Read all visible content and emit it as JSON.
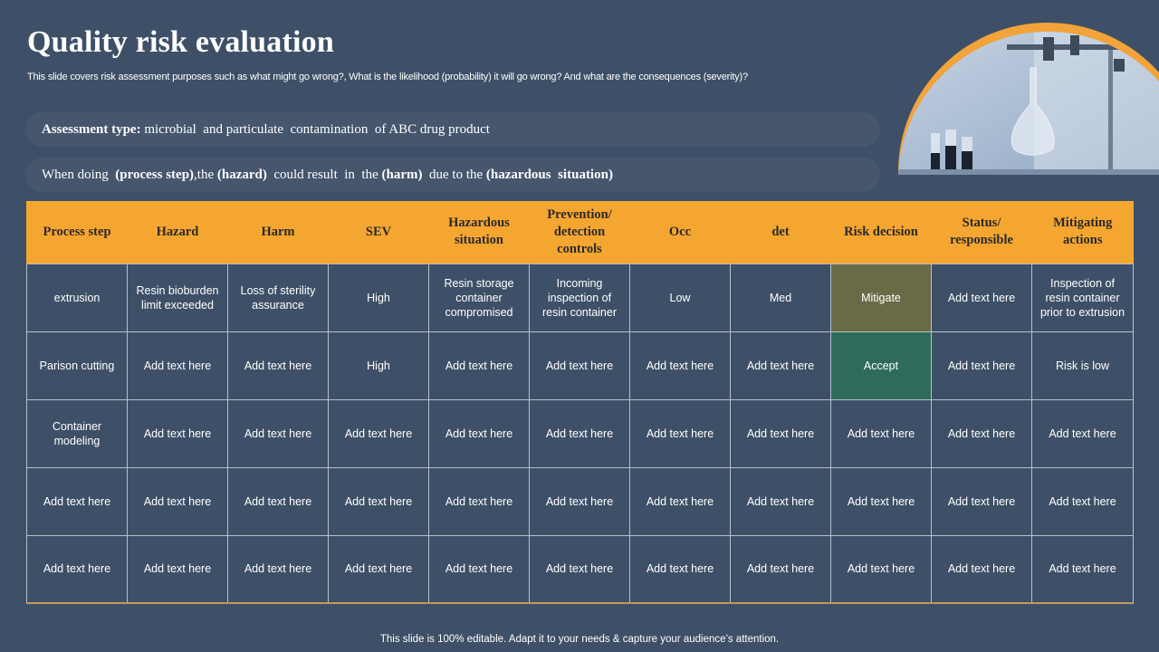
{
  "slide": {
    "title": "Quality risk evaluation",
    "subtitle": "This slide covers risk assessment purposes such as what might go wrong?, What is the likelihood (probability) it will go wrong? And what are the consequences (severity)?",
    "assessment_label": "Assessment type:",
    "assessment_text": " microbial  and particulate  contamination  of ABC drug product",
    "formula": {
      "p1": "When doing  ",
      "b1": "(process step)",
      "p2": ",the ",
      "b2": "(hazard)",
      "p3": "  could result  in  the ",
      "b3": "(harm)",
      "p4": "  due to the ",
      "b4": "(hazardous  situation)"
    },
    "footer": "This slide is 100% editable. Adapt it to your needs & capture your audience’s attention."
  },
  "table": {
    "headers": [
      "Process step",
      "Hazard",
      "Harm",
      "SEV",
      "Hazardous situation",
      "Prevention/ detection controls",
      "Occ",
      "det",
      "Risk decision",
      "Status/ responsible",
      "Mitigating actions"
    ],
    "rows": [
      [
        "extrusion",
        "Resin bioburden limit exceeded",
        "Loss of sterility assurance",
        "High",
        "Resin storage container compromised",
        "Incoming inspection of resin container",
        "Low",
        "Med",
        "Mitigate",
        "Add text here",
        "Inspection of resin container prior to extrusion"
      ],
      [
        "Parison cutting",
        "Add text here",
        "Add text here",
        "High",
        "Add text here",
        "Add text here",
        "Add text here",
        "Add text here",
        "Accept",
        "Add text here",
        "Risk is low"
      ],
      [
        "Container modeling",
        "Add text here",
        "Add text here",
        "Add text here",
        "Add text here",
        "Add text here",
        "Add text here",
        "Add text here",
        "Add text here",
        "Add text here",
        "Add text here"
      ],
      [
        "Add text here",
        "Add text here",
        "Add text here",
        "Add text here",
        "Add text here",
        "Add text here",
        "Add text here",
        "Add text here",
        "Add text here",
        "Add text here",
        "Add text here"
      ],
      [
        "Add text here",
        "Add text here",
        "Add text here",
        "Add text here",
        "Add text here",
        "Add text here",
        "Add text here",
        "Add text here",
        "Add text here",
        "Add text here",
        "Add text here"
      ]
    ]
  },
  "colors": {
    "background": "#3e5067",
    "header": "#f5a631",
    "mitigate": "#6b6a46",
    "accept": "#2e6b5a"
  },
  "image": {
    "icon": "laboratory-flask-photo"
  }
}
